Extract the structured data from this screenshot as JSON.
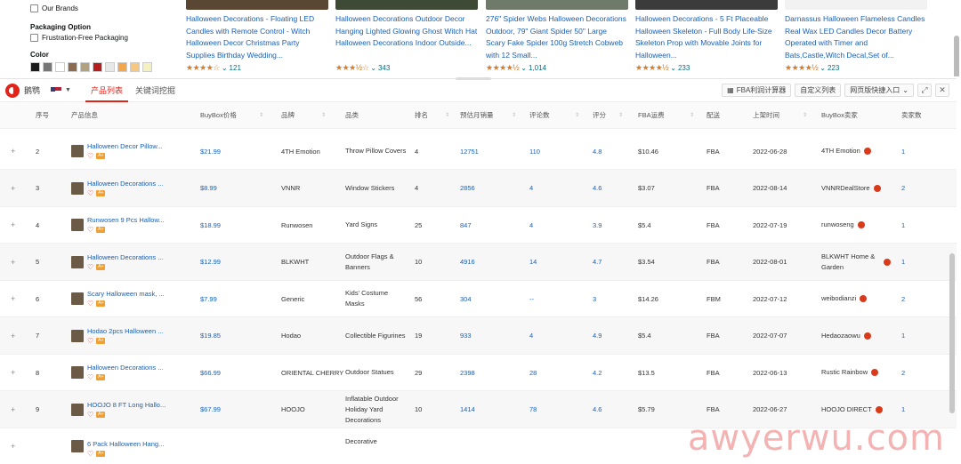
{
  "amazon": {
    "filters": {
      "our_brands": "Our Brands",
      "packaging_title": "Packaging Option",
      "frustration_free": "Frustration-Free Packaging",
      "color_title": "Color",
      "swatches": [
        "#1b1b1b",
        "#777777",
        "#ffffff",
        "#8a6b4f",
        "#b0a27f",
        "#b51e1e",
        "#e8e8e8",
        "#f3a64a",
        "#f7c77f",
        "#f5f0c0"
      ]
    },
    "products": [
      {
        "title": "Halloween Decorations - Floating LED Candles with Remote Control - Witch Halloween Decor Christmas Party Supplies Birthday Wedding...",
        "stars": "★★★★☆",
        "count": "121"
      },
      {
        "title": "Halloween Decorations Outdoor Decor Hanging Lighted Glowing Ghost Witch Hat Halloween Decorations Indoor Outside...",
        "stars": "★★★½☆",
        "count": "343"
      },
      {
        "title": "276\" Spider Webs Halloween Decorations Outdoor, 79\" Giant Spider 50\" Large Scary Fake Spider 100g Stretch Cobweb with 12 Small...",
        "stars": "★★★★½",
        "count": "1,014"
      },
      {
        "title": "Halloween Decorations - 5 Ft Placeable Halloween Skeleton - Full Body Life-Size Skeleton Prop with Movable Joints for Halloween...",
        "stars": "★★★★½",
        "count": "233"
      },
      {
        "title": "Darnassus Halloween Flameless Candles Real Wax LED Candles Decor Battery Operated with Timer and Bats,Castle,Witch Decal,Set of...",
        "stars": "★★★★½",
        "count": "223"
      }
    ]
  },
  "plugin": {
    "app_name": "鹅鹗",
    "tabs": [
      "产品列表",
      "关键词挖掘"
    ],
    "tools": {
      "fba_calc": "FBA利润计算器",
      "custom_list": "自定义列表",
      "quick_entry": "网页版快捷入口"
    },
    "headers": {
      "idx": "序号",
      "info": "产品信息",
      "price": "BuyBox价格",
      "brand": "品牌",
      "category": "品类",
      "rank": "排名",
      "sales": "预估月销量",
      "reviews": "评论数",
      "rating": "评分",
      "fba_fee": "FBA运费",
      "fulfill": "配送",
      "date": "上架时间",
      "seller": "BuyBox卖家",
      "seller_count": "卖家数"
    },
    "rows": [
      {
        "idx": "2",
        "title": "Halloween Decor Pillow...",
        "price": "$21.99",
        "brand": "4TH Emotion",
        "category": "Throw Pillow Covers",
        "rank": "4",
        "sales": "12751",
        "reviews": "110",
        "rating": "4.8",
        "fee": "$10.46",
        "fulfill": "FBA",
        "date": "2022-06-28",
        "seller": "4TH Emotion",
        "count": "1"
      },
      {
        "idx": "3",
        "title": "Halloween Decorations ...",
        "price": "$8.99",
        "brand": "VNNR",
        "category": "Window Stickers",
        "rank": "4",
        "sales": "2856",
        "reviews": "4",
        "rating": "4.6",
        "fee": "$3.07",
        "fulfill": "FBA",
        "date": "2022-08-14",
        "seller": "VNNRDealStore",
        "count": "2"
      },
      {
        "idx": "4",
        "title": "Runwosen 9 Pcs Hallow...",
        "price": "$18.99",
        "brand": "Runwosen",
        "category": "Yard Signs",
        "rank": "25",
        "sales": "847",
        "reviews": "4",
        "rating": "3.9",
        "fee": "$5.4",
        "fulfill": "FBA",
        "date": "2022-07-19",
        "seller": "runwoseng",
        "count": "1"
      },
      {
        "idx": "5",
        "title": "Halloween Decorations ...",
        "price": "$12.99",
        "brand": "BLKWHT",
        "category": "Outdoor Flags & Banners",
        "rank": "10",
        "sales": "4916",
        "reviews": "14",
        "rating": "4.7",
        "fee": "$3.54",
        "fulfill": "FBA",
        "date": "2022-08-01",
        "seller": "BLKWHT Home & Garden",
        "count": "1"
      },
      {
        "idx": "6",
        "title": "Scary Halloween mask, ...",
        "price": "$7.99",
        "brand": "Generic",
        "category": "Kids' Costume Masks",
        "rank": "56",
        "sales": "304",
        "reviews": "--",
        "rating": "3",
        "fee": "$14.26",
        "fulfill": "FBM",
        "date": "2022-07-12",
        "seller": "weibodianzi",
        "count": "2"
      },
      {
        "idx": "7",
        "title": "Hodao 2pcs Halloween ...",
        "price": "$19.85",
        "brand": "Hodao",
        "category": "Collectible Figurines",
        "rank": "19",
        "sales": "933",
        "reviews": "4",
        "rating": "4.9",
        "fee": "$5.4",
        "fulfill": "FBA",
        "date": "2022-07-07",
        "seller": "Hedaozaowu",
        "count": "1"
      },
      {
        "idx": "8",
        "title": "Halloween Decorations ...",
        "price": "$66.99",
        "brand": "ORIENTAL CHERRY",
        "category": "Outdoor Statues",
        "rank": "29",
        "sales": "2398",
        "reviews": "28",
        "rating": "4.2",
        "fee": "$13.5",
        "fulfill": "FBA",
        "date": "2022-06-13",
        "seller": "Rustic Rainbow",
        "count": "2"
      },
      {
        "idx": "9",
        "title": "HOOJO 8 FT Long Hallo...",
        "price": "$67.99",
        "brand": "HOOJO",
        "category": "Inflatable Outdoor Holiday Yard Decorations",
        "rank": "10",
        "sales": "1414",
        "reviews": "78",
        "rating": "4.6",
        "fee": "$5.79",
        "fulfill": "FBA",
        "date": "2022-06-27",
        "seller": "HOOJO DIRECT",
        "count": "1"
      },
      {
        "idx": "",
        "title": "6 Pack Halloween Hang...",
        "price": "",
        "brand": "",
        "category": "Decorative",
        "rank": "",
        "sales": "",
        "reviews": "",
        "rating": "",
        "fee": "",
        "fulfill": "",
        "date": "",
        "seller": "",
        "count": ""
      }
    ]
  },
  "watermark": "awyerwu.com"
}
